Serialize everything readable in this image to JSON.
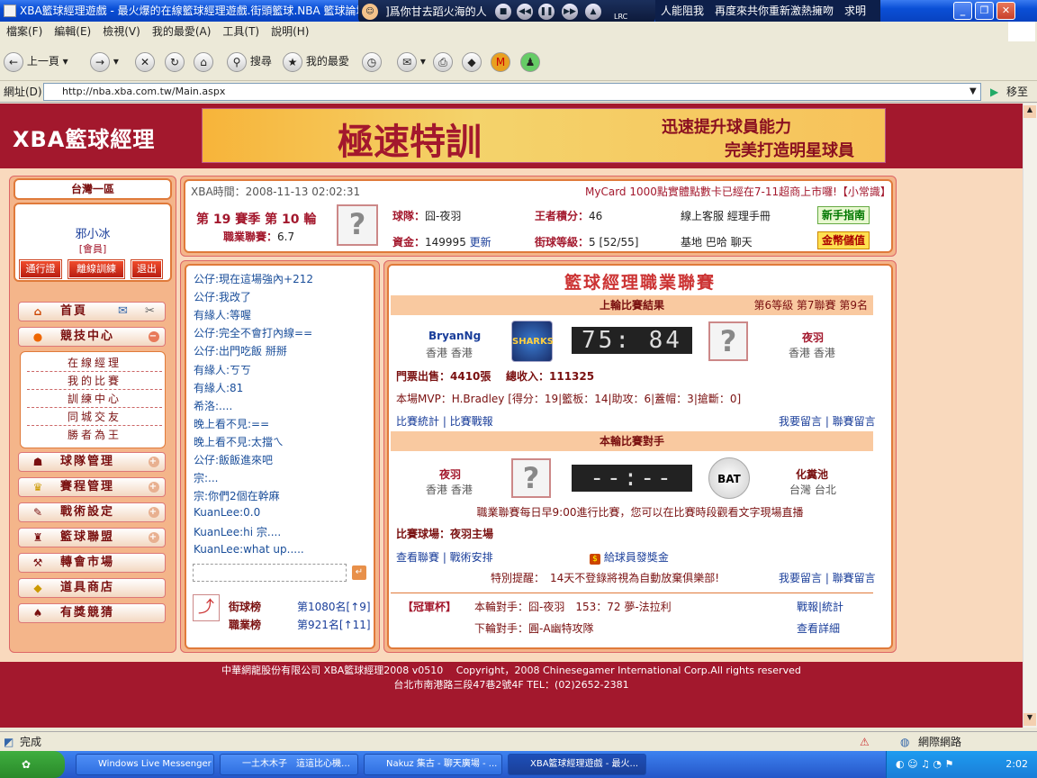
{
  "window": {
    "title": "XBA籃球經理遊戲 - 最火爆的在線籃球經理遊戲.街頭籃球.NBA 籃球論壇"
  },
  "media": {
    "song": "]爲你甘去蹈火海的人",
    "lyric": "人能阻我　再度來共你重新激熱擁吻　求明",
    "lrc": "LRC"
  },
  "menu": [
    "檔案(F)",
    "編輯(E)",
    "檢視(V)",
    "我的最愛(A)",
    "工具(T)",
    "說明(H)"
  ],
  "toolbar": {
    "back": "上一頁",
    "search": "搜尋",
    "favorites": "我的最愛"
  },
  "address": {
    "label": "網址(D)",
    "url": "http://nba.xba.com.tw/Main.aspx",
    "go": "移至"
  },
  "site": {
    "logo": "XBA籃球經理",
    "banner_main": "極速特訓",
    "banner_sub1": "迅速提升球員能力",
    "banner_sub2": "完美打造明星球員"
  },
  "user": {
    "server": "台灣一區",
    "name": "邪小冰",
    "role": "[會員]",
    "btn_pass": "通行證",
    "btn_train": "離線訓練",
    "btn_exit": "退出"
  },
  "nav": {
    "home": "首頁",
    "arena": "競技中心",
    "sub": [
      "在線經理",
      "我的比賽",
      "訓練中心",
      "同城交友",
      "勝者為王"
    ],
    "items": [
      "球隊管理",
      "賽程管理",
      "戰術設定",
      "籃球聯盟",
      "轉會市場",
      "道具商店",
      "有獎競猜"
    ]
  },
  "info": {
    "time_label": "XBA時間：",
    "time": "2008-11-13 02:02:31",
    "notice": "MyCard 1000點實體點數卡已經在7-11超商上市囉!【小常識】",
    "season": "第 19 賽季 第 10 輪",
    "pro_label": "職業聯賽：",
    "pro": "6.7",
    "team_label": "球隊：",
    "team": "囧-夜羽",
    "king_label": "王者積分：",
    "king": "46",
    "money_label": "資金：",
    "money": "149995",
    "update": "更新",
    "level_label": "街球等級：",
    "level": "5 [52/55]",
    "links1": "線上客服 經理手冊",
    "links2": "基地 巴哈 聊天",
    "guide": "新手指南",
    "pay": "金幣儲值"
  },
  "chat": [
    "公仔:現在這場強內+212",
    "公仔:我改了",
    "有緣人:等喔",
    "公仔:完全不會打內線==",
    "公仔:出門吃飯 掰掰",
    "有緣人:ㄎㄎ",
    "有緣人:81",
    "希洛:....",
    "晚上看不見:==",
    "晚上看不見:太擋ㄟ",
    "公仔:飯飯進來吧",
    "宗:...",
    "宗:你們2個在幹麻",
    "KuanLee:0.0",
    "KuanLee:hi 宗....",
    "KuanLee:what up....."
  ],
  "rank": {
    "street_label": "街球榜",
    "street": "第1080名[↑9]",
    "pro_label": "職業榜",
    "pro": "第921名[↑11]"
  },
  "league": {
    "title": "籃球經理職業聯賽",
    "last_title": "上輪比賽結果",
    "last_rank": "第6等級 第7聯賽 第9名",
    "home_team": "BryanNg",
    "home_loc": "香港 香港",
    "home_logo": "SHARKS",
    "score": "75: 84",
    "away_team": "夜羽",
    "away_loc": "香港 香港",
    "gate": "門票出售：4410張",
    "income": "總收入：111325",
    "mvp": "本場MVP：H.Bradley [得分：19|籃板：14|助攻：6|蓋帽：3|搶斷：0]",
    "stats": "比賽統計 | 比賽戰報",
    "msg": "我要留言 | 聯賽留言",
    "next_title": "本輪比賽對手",
    "n_home": "夜羽",
    "n_home_loc": "香港 香港",
    "n_score": "--:--",
    "n_away": "化糞池",
    "n_away_loc": "台灣 台北",
    "n_away_logo": "BAT",
    "schedule": "職業聯賽每日早9:00進行比賽，您可以在比賽時段觀看文字現場直播",
    "venue": "比賽球場：夜羽主場",
    "links": "查看聯賽 | 戰術安排",
    "bonus": "給球員發獎金",
    "warn": "特別提醒：　14天不登錄將視為自動放棄俱樂部!",
    "msg2": "我要留言 | 聯賽留言",
    "cup": "【冠軍杯】",
    "cup_now": "本輪對手：囧-夜羽　153：72 夢-法拉利",
    "cup_next": "下輪對手：圓-A幽特攻隊",
    "cup_l1": "戰報|統計",
    "cup_l2": "查看詳細"
  },
  "footer": {
    "line1": "中華網龍股份有限公司 XBA籃球經理2008 v0510　 Copyright，2008 Chinesegamer International Corp.All rights reserved",
    "line2": "台北市南港路三段47巷2號4F TEL：(02)2652-2381"
  },
  "status": {
    "done": "完成",
    "zone": "網際網路"
  },
  "taskbar": [
    "Windows Live Messenger",
    "一土木木子　這這比心機…",
    "Nakuz 集古 - 聊天廣場 - ...",
    "XBA籃球經理遊戲 - 最火..."
  ],
  "tray": {
    "time": "2:02"
  }
}
